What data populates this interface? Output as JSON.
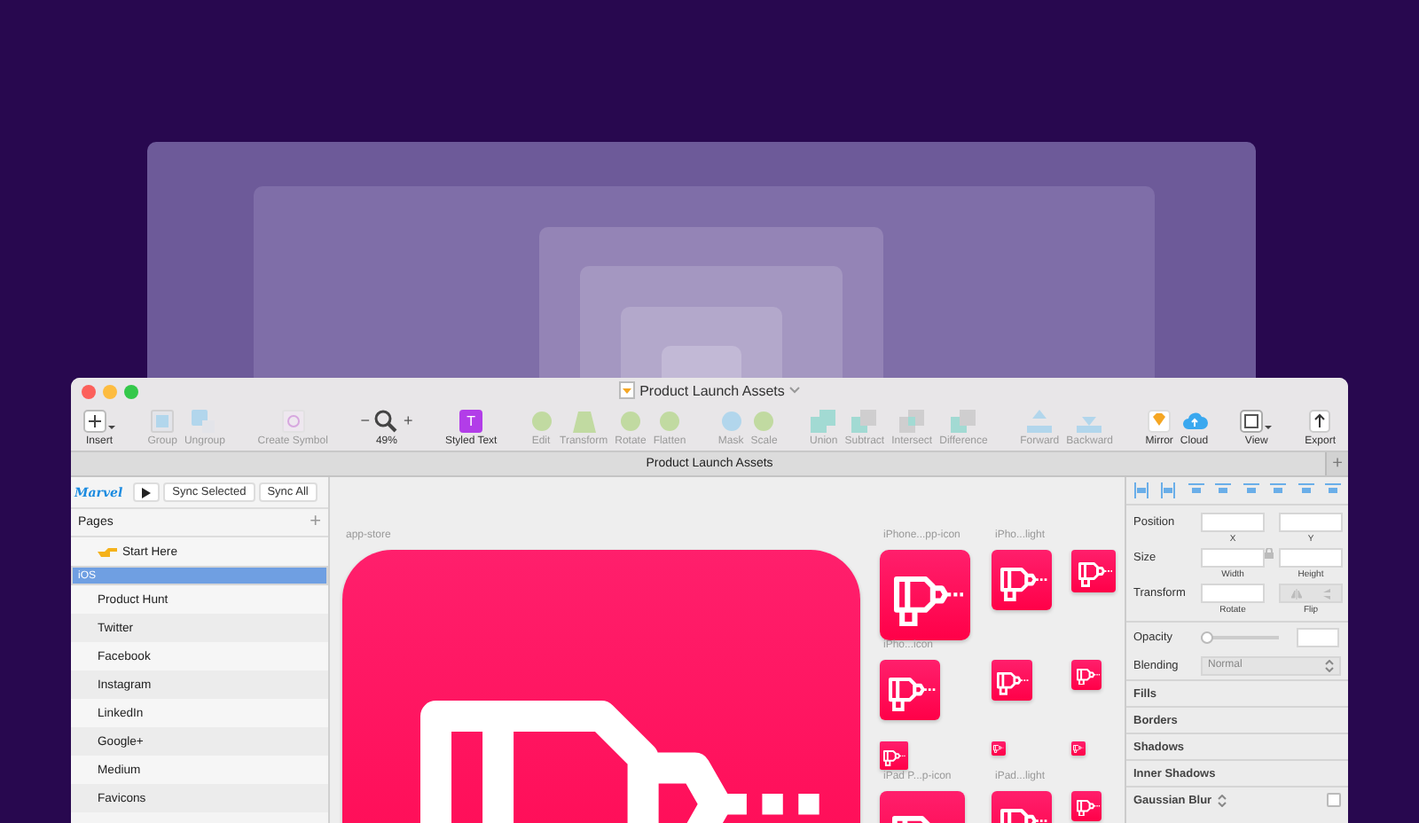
{
  "window": {
    "title": "Product Launch Assets",
    "tab": "Product Launch Assets",
    "tab_add": "+"
  },
  "toolbar": {
    "groups": [
      [
        {
          "kind": "insert",
          "label": "Insert",
          "enabled": true
        }
      ],
      [
        {
          "kind": "group",
          "label": "Group",
          "enabled": false
        },
        {
          "kind": "ungroup",
          "label": "Ungroup",
          "enabled": false
        }
      ],
      [
        {
          "kind": "symbol",
          "label": "Create Symbol",
          "enabled": false
        }
      ],
      [
        {
          "kind": "zoom",
          "label": "49%",
          "enabled": true,
          "minus": "−",
          "plus": "+"
        }
      ],
      [
        {
          "kind": "text",
          "label": "Styled Text",
          "enabled": true,
          "glyph": "T"
        }
      ],
      [
        {
          "kind": "edit",
          "label": "Edit",
          "enabled": false
        },
        {
          "kind": "transform",
          "label": "Transform",
          "enabled": false
        },
        {
          "kind": "rotate",
          "label": "Rotate",
          "enabled": false
        },
        {
          "kind": "flatten",
          "label": "Flatten",
          "enabled": false
        }
      ],
      [
        {
          "kind": "mask",
          "label": "Mask",
          "enabled": false
        },
        {
          "kind": "scale",
          "label": "Scale",
          "enabled": false
        }
      ],
      [
        {
          "kind": "union",
          "label": "Union",
          "enabled": false
        },
        {
          "kind": "subtract",
          "label": "Subtract",
          "enabled": false
        },
        {
          "kind": "intersect",
          "label": "Intersect",
          "enabled": false
        },
        {
          "kind": "difference",
          "label": "Difference",
          "enabled": false
        }
      ],
      [
        {
          "kind": "forward",
          "label": "Forward",
          "enabled": false
        },
        {
          "kind": "backward",
          "label": "Backward",
          "enabled": false
        }
      ],
      [
        {
          "kind": "mirror",
          "label": "Mirror",
          "enabled": true
        },
        {
          "kind": "cloud",
          "label": "Cloud",
          "enabled": true
        }
      ],
      [
        {
          "kind": "view",
          "label": "View",
          "enabled": true
        }
      ],
      [
        {
          "kind": "export",
          "label": "Export",
          "enabled": true
        }
      ]
    ]
  },
  "sidebar": {
    "logo": "Marvel",
    "sync_selected": "Sync Selected",
    "sync_all": "Sync All",
    "pages_title": "Pages",
    "pages_add": "+",
    "pages": [
      {
        "label": "Start Here",
        "selected": false,
        "kind": "pointer"
      },
      {
        "label": "iOS",
        "selected": true,
        "kind": "plain"
      },
      {
        "label": "Product Hunt",
        "selected": false,
        "kind": "plain"
      },
      {
        "label": "Twitter",
        "selected": false,
        "kind": "plain"
      },
      {
        "label": "Facebook",
        "selected": false,
        "kind": "plain"
      },
      {
        "label": "Instagram",
        "selected": false,
        "kind": "plain"
      },
      {
        "label": "LinkedIn",
        "selected": false,
        "kind": "plain"
      },
      {
        "label": "Google+",
        "selected": false,
        "kind": "plain"
      },
      {
        "label": "Medium",
        "selected": false,
        "kind": "plain"
      },
      {
        "label": "Favicons",
        "selected": false,
        "kind": "plain"
      }
    ]
  },
  "canvas": {
    "artboards": [
      {
        "kind": "titled",
        "label": "app-store"
      },
      {
        "kind": "titled",
        "label": "iPhone...pp-icon"
      },
      {
        "kind": "titled",
        "label": "iPho...light"
      },
      {
        "kind": "untitled"
      },
      {
        "kind": "titled",
        "label": "iPho...icon"
      },
      {
        "kind": "untitled"
      },
      {
        "kind": "untitled"
      },
      {
        "kind": "untitled"
      },
      {
        "kind": "untitled"
      },
      {
        "kind": "untitled"
      },
      {
        "kind": "titled",
        "label": "iPad P...p-icon"
      },
      {
        "kind": "titled",
        "label": "iPad...light"
      },
      {
        "kind": "untitled"
      }
    ]
  },
  "inspector": {
    "position": {
      "label": "Position",
      "x": "X",
      "y": "Y"
    },
    "size": {
      "label": "Size",
      "width": "Width",
      "height": "Height"
    },
    "transform": {
      "label": "Transform",
      "rotate": "Rotate",
      "flip": "Flip"
    },
    "opacity": {
      "label": "Opacity",
      "level": 0
    },
    "blending": {
      "label": "Blending",
      "value": "Normal"
    },
    "sections": [
      {
        "label": "Fills",
        "kind": "plain"
      },
      {
        "label": "Borders",
        "kind": "plain"
      },
      {
        "label": "Shadows",
        "kind": "plain"
      },
      {
        "label": "Inner Shadows",
        "kind": "plain"
      },
      {
        "label": "Gaussian Blur",
        "kind": "toggle",
        "checked": false
      }
    ]
  }
}
